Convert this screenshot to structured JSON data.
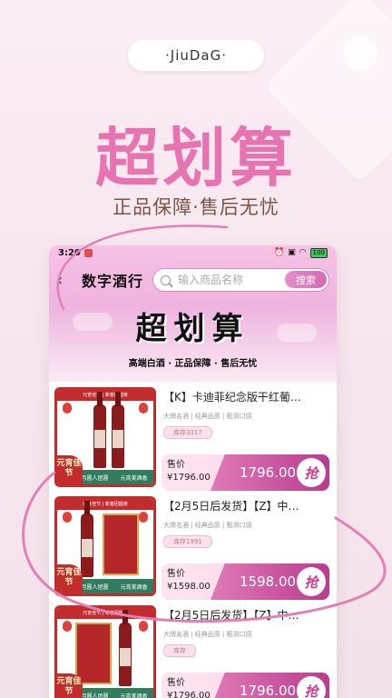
{
  "brand": "·JiuDaG·",
  "hero": {
    "title": "超划算",
    "subtitle": "正品保障·售后无忧"
  },
  "status_bar": {
    "time": "3:20",
    "battery": "100"
  },
  "header": {
    "store_name": "数字酒行",
    "search_placeholder": "输入商品名称",
    "search_button": "搜索",
    "banner_title": "超划算",
    "banner_subtitle": "高端白酒 · 正品保障 · 售后无忧"
  },
  "thumb_common": {
    "top_text": "元宵佳节 | 新春团圆夜",
    "corner": "元宵佳节",
    "bottom_left": "月圆人团圆",
    "bottom_right": "元宵美酒香"
  },
  "products": [
    {
      "title": "【K】卡迪菲纪念版干红葡…",
      "tags": "大牌名酒 | 经典品质 | 甄滑口感",
      "stock": "库存3317",
      "price_label": "售价",
      "price": "¥1796.00",
      "price_big": "1796.00",
      "grab": "抢"
    },
    {
      "title": "【2月5日后发货】【Z】中…",
      "tags": "大牌名酒 | 经典品质 | 甄滑口感",
      "stock": "库存1991",
      "price_label": "售价",
      "price": "¥1598.00",
      "price_big": "1598.00",
      "grab": "抢"
    },
    {
      "title": "【2月5日后发货】【Z】中…",
      "tags": "大牌名酒 | 经典品质 | 甄滑口感",
      "stock": "库存",
      "price_label": "售价",
      "price": "¥1796.00",
      "price_big": "1796.00",
      "grab": "抢"
    }
  ],
  "colors": {
    "accent": "#e774b0",
    "price_gradient_end": "#b93b8f",
    "thumb_red": "#c22c2c"
  }
}
